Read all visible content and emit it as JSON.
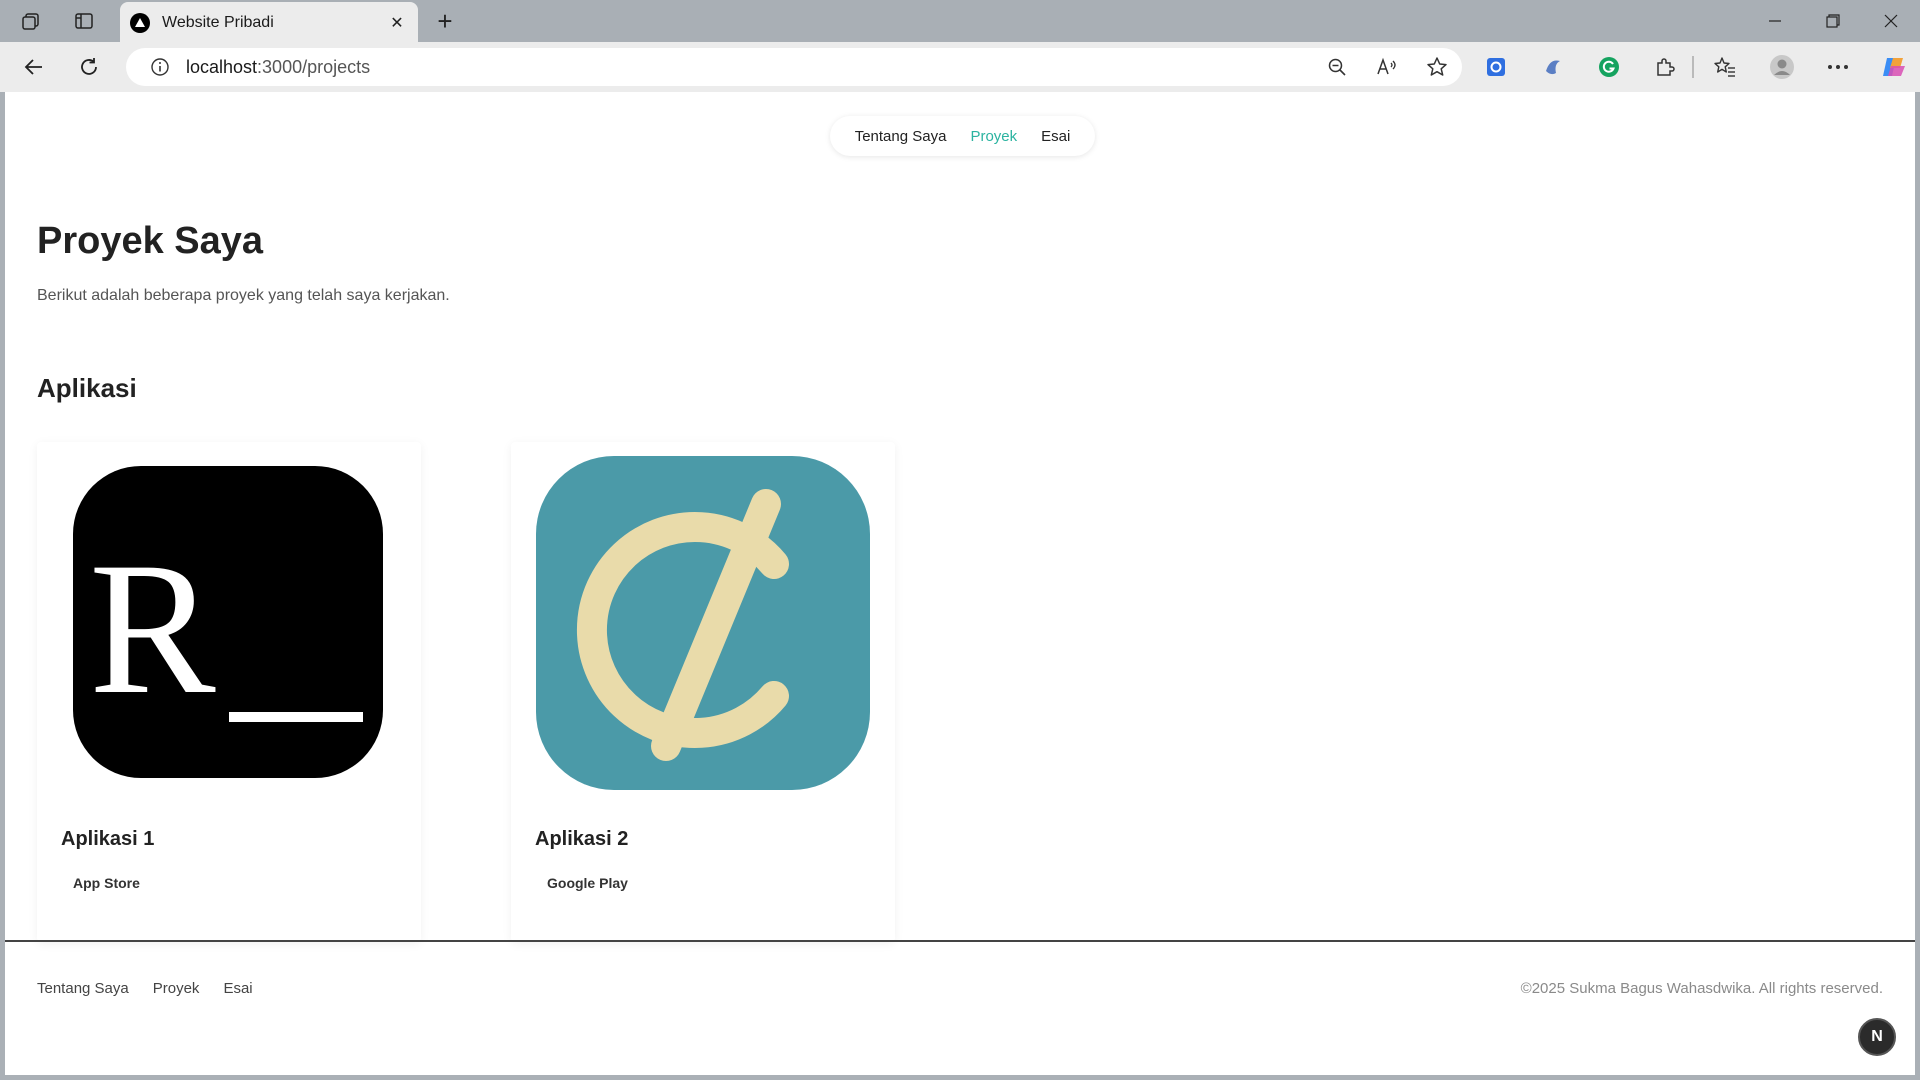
{
  "browser": {
    "tab_title": "Website Pribadi",
    "url_host": "localhost",
    "url_path": ":3000/projects",
    "new_tab_label": "+",
    "tab_close_label": "✕"
  },
  "topnav": {
    "items": [
      {
        "label": "Tentang Saya",
        "active": false
      },
      {
        "label": "Proyek",
        "active": true
      },
      {
        "label": "Esai",
        "active": false
      }
    ]
  },
  "page": {
    "title": "Proyek Saya",
    "subtitle": "Berikut adalah beberapa proyek yang telah saya kerjakan.",
    "section_title": "Aplikasi"
  },
  "cards": [
    {
      "name": "Aplikasi 1",
      "store": "App Store",
      "icon": "r-terminal-app-icon",
      "icon_letter": "R",
      "icon_bg": "#000000"
    },
    {
      "name": "Aplikasi 2",
      "store": "Google Play",
      "icon": "cent-sign-app-icon",
      "icon_bg": "#4b9aa8",
      "icon_fg": "#e9dbaa"
    }
  ],
  "footer": {
    "links": [
      "Tentang Saya",
      "Proyek",
      "Esai"
    ],
    "copyright": "©2025 Sukma Bagus Wahasdwika. All rights reserved.",
    "badge": "N"
  },
  "colors": {
    "accent": "#2bb3a0",
    "tabbar": "#a9afb5",
    "toolbar": "#ececec"
  }
}
